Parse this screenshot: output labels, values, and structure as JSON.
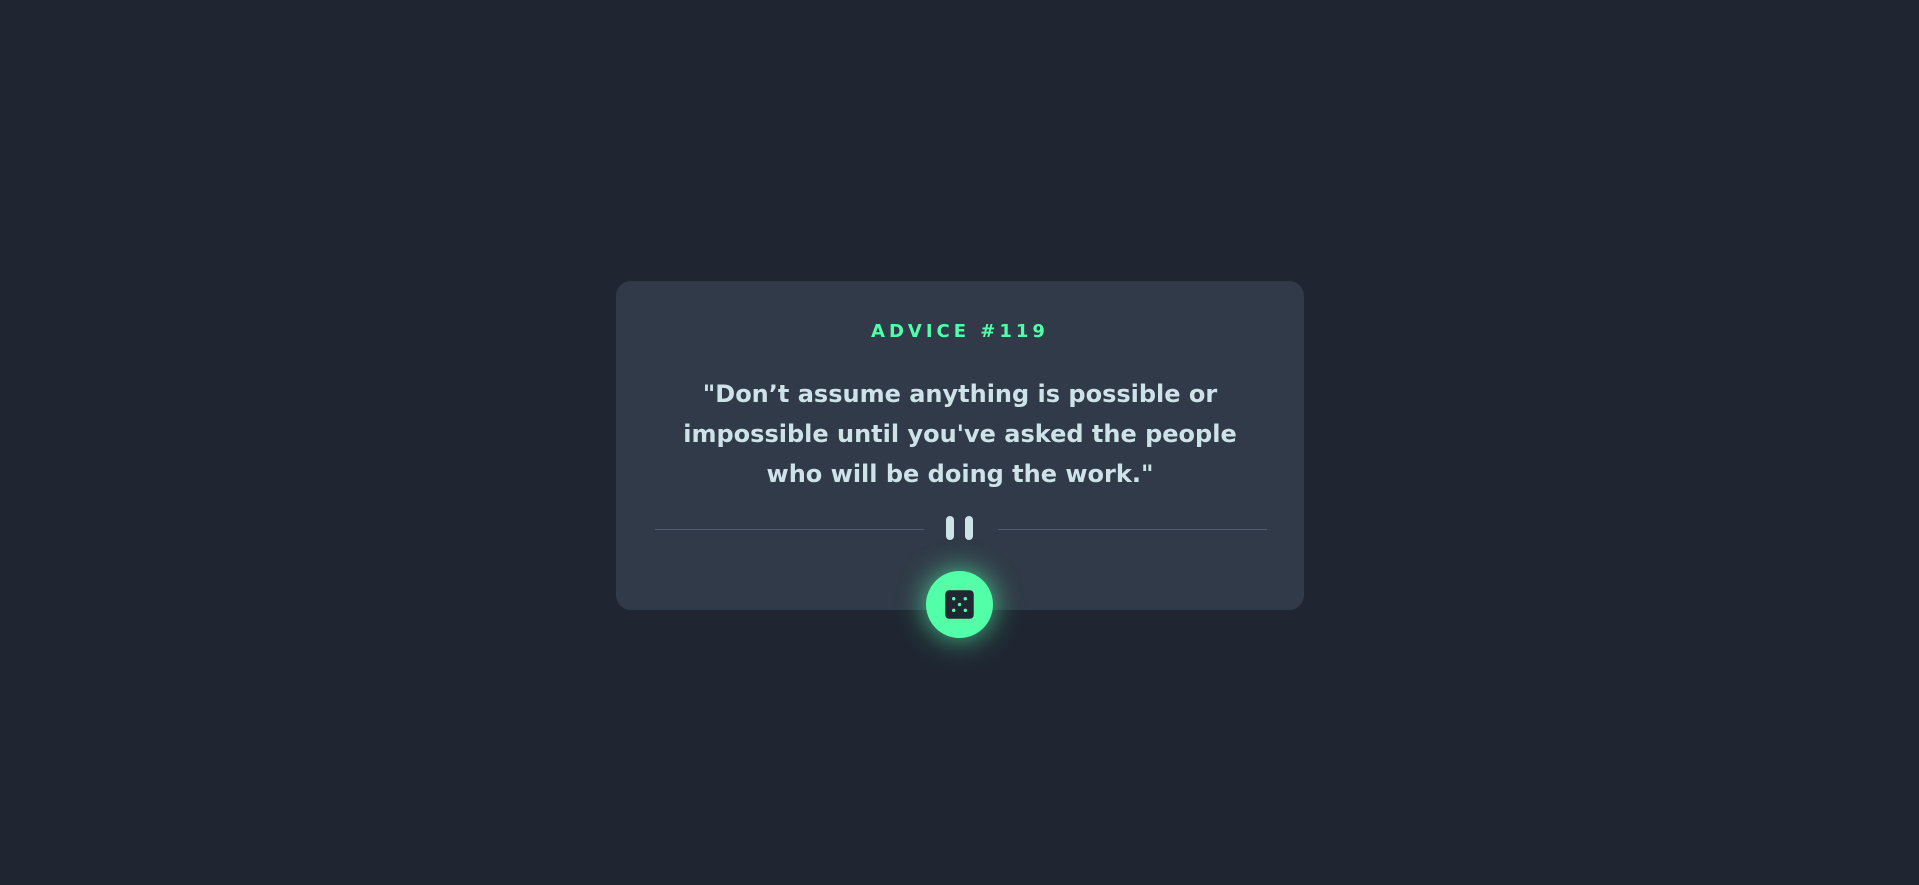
{
  "advice": {
    "label": "ADVICE #119",
    "text": "\"Don’t assume anything is possible or impossible until you've asked the people who will be doing the work.\""
  },
  "colors": {
    "background": "#1f2632",
    "card": "#313a48",
    "accent": "#52ffa8",
    "text": "#cee3e9",
    "divider": "#4f5d74"
  },
  "icons": {
    "divider": "pause-icon",
    "button": "dice-icon"
  }
}
